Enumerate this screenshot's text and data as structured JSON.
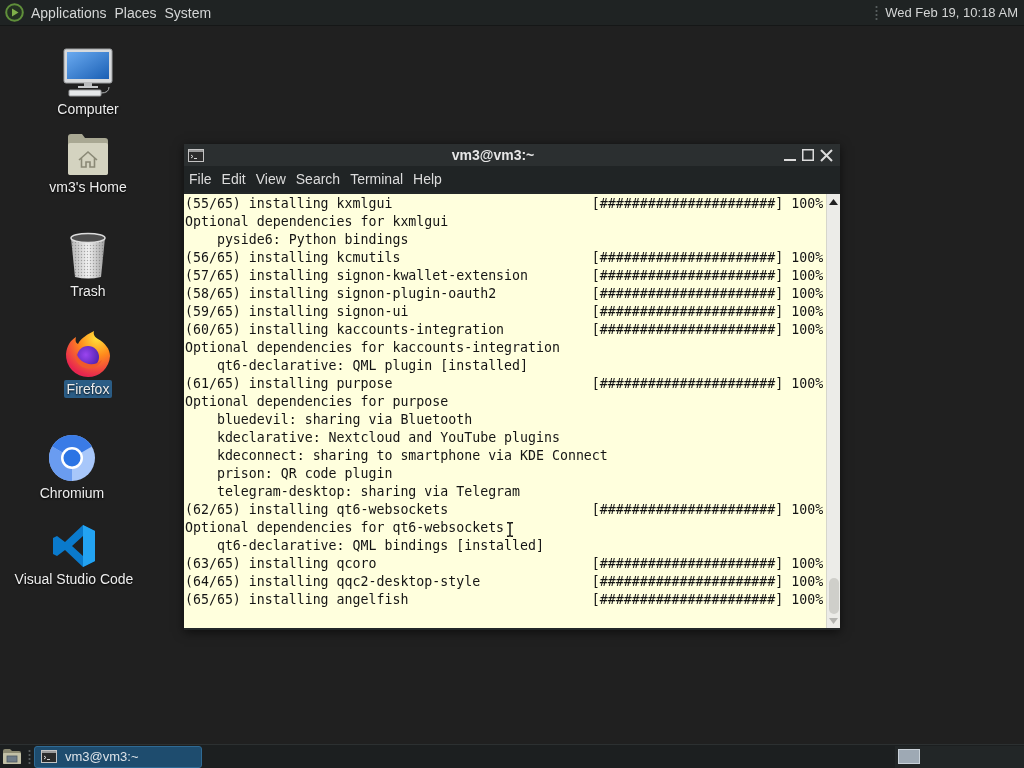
{
  "top_panel": {
    "menus": [
      "Applications",
      "Places",
      "System"
    ],
    "clock": "Wed Feb 19, 10:18 AM"
  },
  "desktop_icons": [
    {
      "label": "Computer",
      "kind": "computer",
      "selected": false
    },
    {
      "label": "vm3's Home",
      "kind": "home",
      "selected": false
    },
    {
      "label": "Trash",
      "kind": "trash",
      "selected": false
    },
    {
      "label": "Firefox",
      "kind": "firefox",
      "selected": true
    },
    {
      "label": "Chromium",
      "kind": "chromium",
      "selected": false
    },
    {
      "label": "Visual Studio Code",
      "kind": "vscode",
      "selected": false
    }
  ],
  "terminal_window": {
    "title": "vm3@vm3:~",
    "menu": [
      "File",
      "Edit",
      "View",
      "Search",
      "Terminal",
      "Help"
    ],
    "lines": [
      {
        "kind": "progress",
        "text": "(55/65) installing kxmlgui",
        "bar": "[######################]",
        "percent": "100%"
      },
      {
        "kind": "plain",
        "text": "Optional dependencies for kxmlgui"
      },
      {
        "kind": "indented",
        "text": "pyside6: Python bindings"
      },
      {
        "kind": "progress",
        "text": "(56/65) installing kcmutils",
        "bar": "[######################]",
        "percent": "100%"
      },
      {
        "kind": "progress",
        "text": "(57/65) installing signon-kwallet-extension",
        "bar": "[######################]",
        "percent": "100%"
      },
      {
        "kind": "progress",
        "text": "(58/65) installing signon-plugin-oauth2",
        "bar": "[######################]",
        "percent": "100%"
      },
      {
        "kind": "progress",
        "text": "(59/65) installing signon-ui",
        "bar": "[######################]",
        "percent": "100%"
      },
      {
        "kind": "progress",
        "text": "(60/65) installing kaccounts-integration",
        "bar": "[######################]",
        "percent": "100%"
      },
      {
        "kind": "plain",
        "text": "Optional dependencies for kaccounts-integration"
      },
      {
        "kind": "indented",
        "text": "qt6-declarative: QML plugin [installed]"
      },
      {
        "kind": "progress",
        "text": "(61/65) installing purpose",
        "bar": "[######################]",
        "percent": "100%"
      },
      {
        "kind": "plain",
        "text": "Optional dependencies for purpose"
      },
      {
        "kind": "indented",
        "text": "bluedevil: sharing via Bluetooth"
      },
      {
        "kind": "indented",
        "text": "kdeclarative: Nextcloud and YouTube plugins"
      },
      {
        "kind": "indented",
        "text": "kdeconnect: sharing to smartphone via KDE Connect"
      },
      {
        "kind": "indented",
        "text": "prison: QR code plugin"
      },
      {
        "kind": "indented",
        "text": "telegram-desktop: sharing via Telegram"
      },
      {
        "kind": "progress",
        "text": "(62/65) installing qt6-websockets",
        "bar": "[######################]",
        "percent": "100%"
      },
      {
        "kind": "plain",
        "text": "Optional dependencies for qt6-websockets"
      },
      {
        "kind": "indented",
        "text": "qt6-declarative: QML bindings [installed]"
      },
      {
        "kind": "progress",
        "text": "(63/65) installing qcoro",
        "bar": "[######################]",
        "percent": "100%"
      },
      {
        "kind": "progress",
        "text": "(64/65) installing qqc2-desktop-style",
        "bar": "[######################]",
        "percent": "100%"
      },
      {
        "kind": "progress",
        "text": "(65/65) installing angelfish",
        "bar": "[######################]",
        "percent": "100%"
      }
    ]
  },
  "taskbar": {
    "tasks": [
      {
        "label": "vm3@vm3:~",
        "selected": true
      }
    ]
  }
}
